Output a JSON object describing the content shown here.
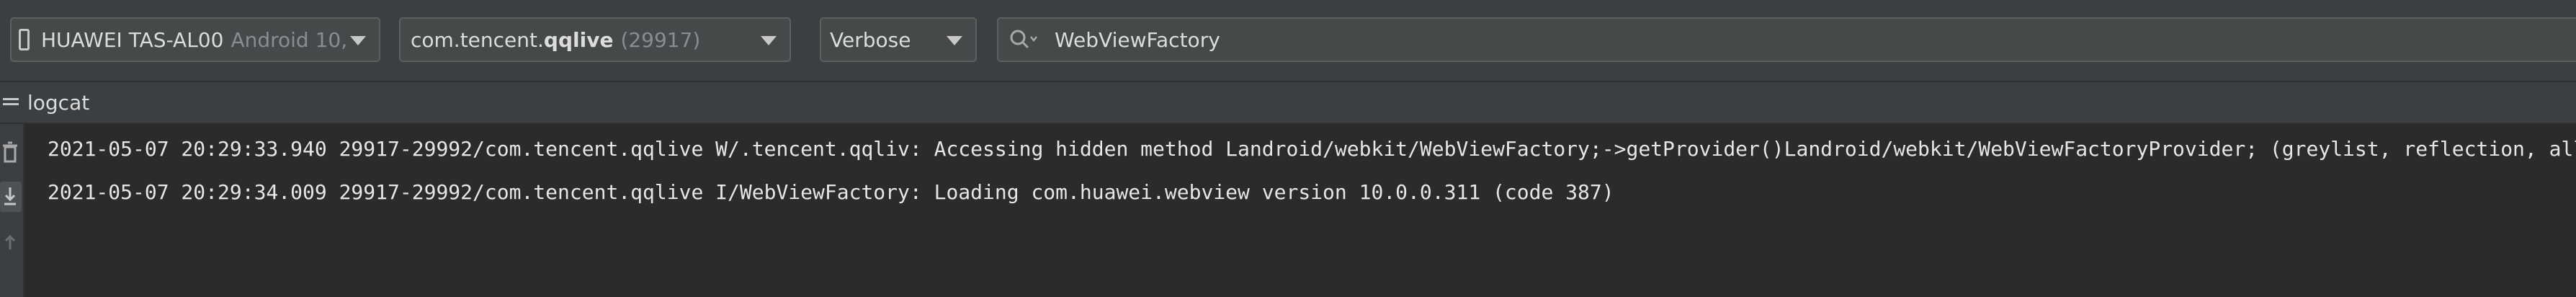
{
  "toolbar": {
    "device": {
      "name": "HUAWEI TAS-AL00",
      "os": "Android 10, "
    },
    "process": {
      "package_prefix": "com.tencent.",
      "package_bold": "qqlive",
      "pid": "(29917)"
    },
    "log_level": "Verbose",
    "search": {
      "value": "WebViewFactory"
    }
  },
  "tab": {
    "label": "logcat"
  },
  "sidebar": {
    "icons": [
      "trash-icon",
      "scroll-to-end-icon",
      "up-arrow-icon"
    ]
  },
  "log": {
    "lines": [
      "2021-05-07 20:29:33.940 29917-29992/com.tencent.qqlive W/.tencent.qqliv: Accessing hidden method Landroid/webkit/WebViewFactory;->getProvider()Landroid/webkit/WebViewFactoryProvider; (greylist, reflection, allowed)",
      "2021-05-07 20:29:34.009 29917-29992/com.tencent.qqlive I/WebViewFactory: Loading com.huawei.webview version 10.0.0.311 (code 387)"
    ]
  },
  "colors": {
    "background": "#2b2b2b",
    "toolbar": "#3c3f41",
    "field": "#45494a",
    "text": "#dcdcdc",
    "muted": "#8a8d8f"
  }
}
